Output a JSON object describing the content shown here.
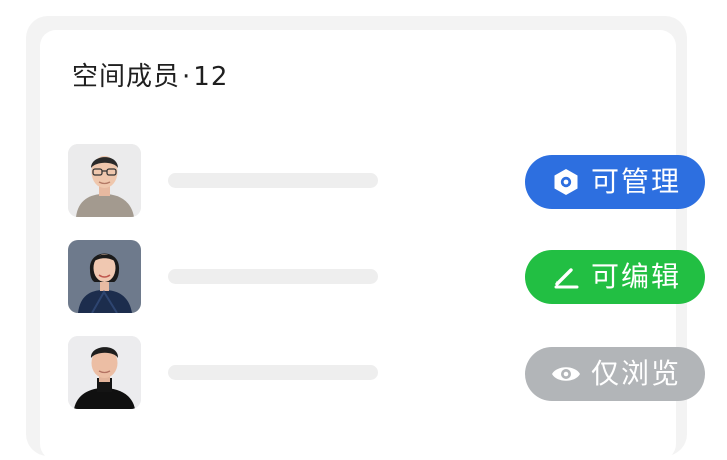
{
  "panel": {
    "title": "空间成员",
    "separator": "·",
    "member_count": "12"
  },
  "members": [
    {
      "avatar_icon": "person-avatar-glasses-man"
    },
    {
      "avatar_icon": "person-avatar-woman"
    },
    {
      "avatar_icon": "person-avatar-man-black-shirt"
    }
  ],
  "permissions": [
    {
      "label": "可管理",
      "icon": "shield-gear-icon",
      "color": "#2d6fe0"
    },
    {
      "label": "可编辑",
      "icon": "pencil-icon",
      "color": "#22bf43"
    },
    {
      "label": "仅浏览",
      "icon": "eye-icon",
      "color": "#b2b5b8"
    }
  ]
}
